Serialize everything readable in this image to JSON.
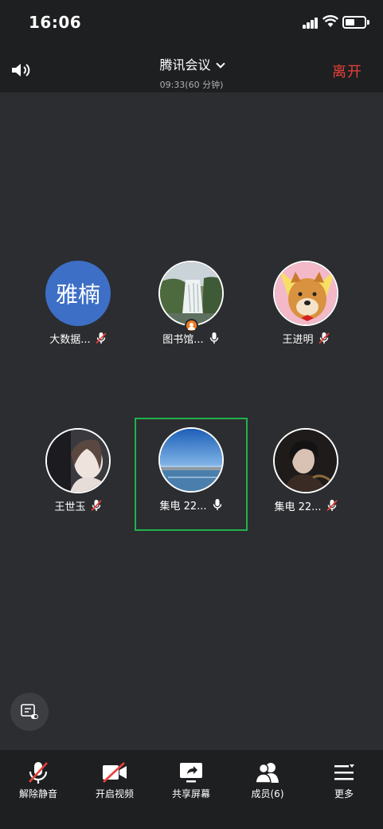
{
  "status_bar": {
    "time": "16:06"
  },
  "header": {
    "title": "腾讯会议",
    "duration": "09:33(60 分钟)",
    "leave_label": "离开"
  },
  "participants": [
    {
      "name": "大数据...",
      "avatar_text": "雅楠",
      "mic": "muted"
    },
    {
      "name": "图书馆...",
      "mic": "on",
      "host": true
    },
    {
      "name": "王进明",
      "mic": "muted"
    },
    {
      "name": "王世玉",
      "mic": "muted"
    },
    {
      "name": "集电 22...",
      "mic": "on",
      "active_speaker": true
    },
    {
      "name": "集电 22...",
      "mic": "muted"
    }
  ],
  "toolbar": {
    "unmute_label": "解除静音",
    "video_label": "开启视频",
    "share_label": "共享屏幕",
    "members_label": "成员(6)",
    "more_label": "更多"
  },
  "colors": {
    "leave": "#e8403a",
    "active_border": "#22b14c",
    "host_badge": "#f07b1d",
    "avatar_blue": "#3d6fc6"
  }
}
